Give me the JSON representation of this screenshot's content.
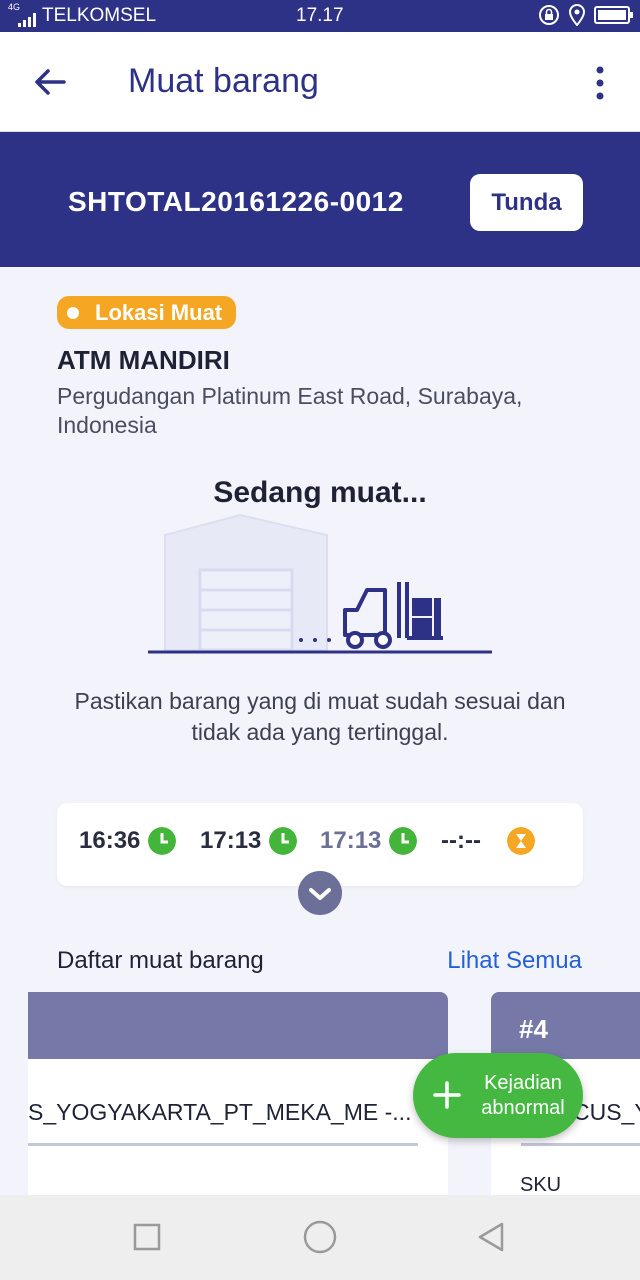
{
  "status_bar": {
    "network": "4G",
    "carrier": "TELKOMSEL",
    "time": "17.17",
    "battery_level": 1.0
  },
  "app_bar": {
    "title": "Muat barang",
    "icons": [
      "arrow-back-icon",
      "more-vertical-icon"
    ]
  },
  "banner": {
    "shipment_code": "SHTOTAL20161226-0012",
    "postpone_label": "Tunda",
    "color": "#2e3286"
  },
  "location": {
    "badge": "Lokasi Muat",
    "name": "ATM MANDIRI",
    "address": "Pergudangan Platinum East Road, Surabaya, Indonesia"
  },
  "loading": {
    "status": "Sedang muat...",
    "instruction": "Pastikan barang yang di muat sudah sesuai dan tidak ada yang tertinggal."
  },
  "timeline": [
    {
      "time": "16:36",
      "icon": "clock-check-icon",
      "color": "#43b53a"
    },
    {
      "time": "17:13",
      "icon": "clock-check-icon",
      "color": "#43b53a"
    },
    {
      "time": "17:13",
      "icon": "clock-check-icon",
      "color": "#43b53a"
    },
    {
      "time": "--:--",
      "icon": "hourglass-icon",
      "color": "#f5a623"
    }
  ],
  "list": {
    "title": "Daftar muat barang",
    "see_all": "Lihat Semua",
    "cards": [
      {
        "number": "",
        "text": "S_YOGYAKARTA_PT_MEKA_ME -..."
      },
      {
        "number": "#4",
        "text": "CUS_YO",
        "label": "SKU"
      }
    ]
  },
  "fab": {
    "label": "Kejadian abnormal",
    "color": "#45b842"
  },
  "nav": [
    "square-icon",
    "circle-icon",
    "triangle-back-icon"
  ]
}
